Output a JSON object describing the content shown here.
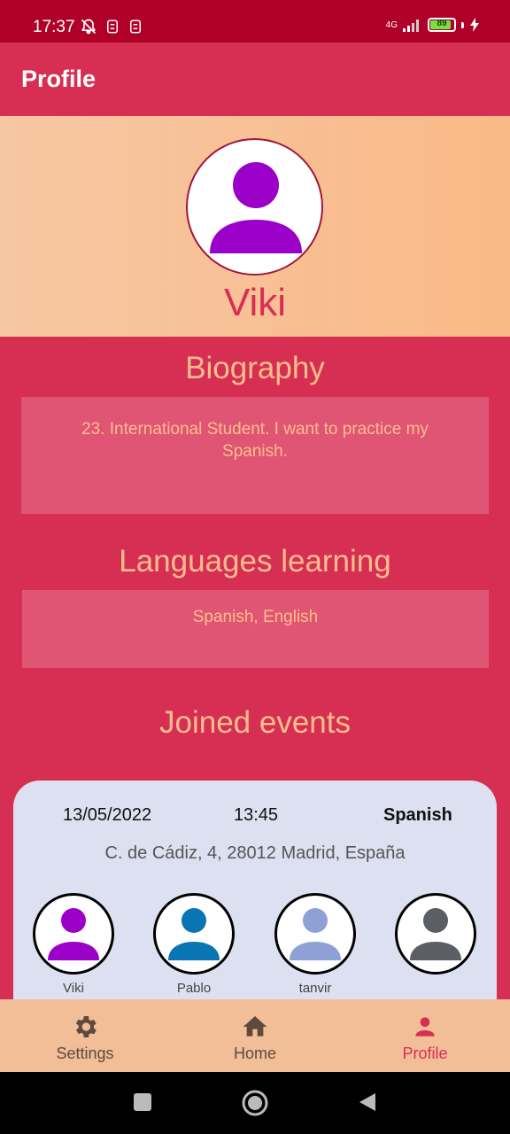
{
  "status_bar": {
    "time": "17:37",
    "network": "4G",
    "battery": "89",
    "battery_level": 0.89
  },
  "app_bar": {
    "title": "Profile"
  },
  "profile": {
    "name": "Viki",
    "avatar_color": "#9b00c9"
  },
  "biography": {
    "title": "Biography",
    "text": "23. International Student. I want to practice my Spanish."
  },
  "languages": {
    "title": "Languages learning",
    "text": "Spanish, English"
  },
  "events": {
    "title": "Joined events",
    "items": [
      {
        "date": "13/05/2022",
        "time": "13:45",
        "language": "Spanish",
        "address": "C. de Cádiz, 4, 28012 Madrid, España",
        "participants": [
          {
            "name": "Viki",
            "color": "#9b00c9"
          },
          {
            "name": "Pablo",
            "color": "#0a75b3"
          },
          {
            "name": "tanvir",
            "color": "#8ea0d6"
          },
          {
            "name": "",
            "color": "#5b5f63"
          }
        ]
      }
    ]
  },
  "bottom_nav": {
    "items": [
      {
        "label": "Settings",
        "icon": "gear-icon"
      },
      {
        "label": "Home",
        "icon": "home-icon"
      },
      {
        "label": "Profile",
        "icon": "person-icon",
        "active": true
      }
    ]
  },
  "colors": {
    "primary": "#d72e54",
    "accent": "#fbbe8b",
    "status_bar": "#b00029"
  }
}
